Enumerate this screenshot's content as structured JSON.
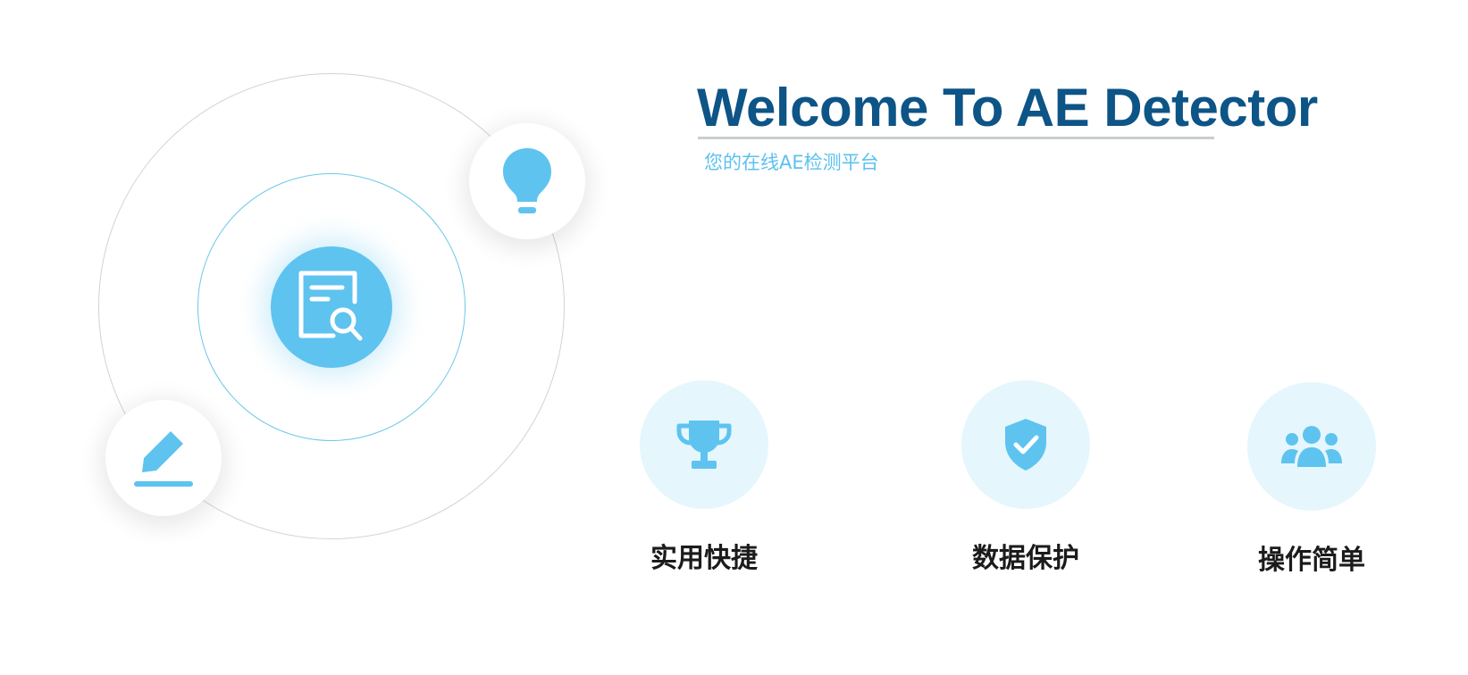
{
  "header": {
    "title": "Welcome To AE Detector",
    "subtitle": "您的在线AE检测平台"
  },
  "illustration": {
    "center_icon": "document-search-icon",
    "satellite_icons": [
      "lightbulb-icon",
      "pencil-icon"
    ]
  },
  "features": [
    {
      "label": "实用快捷",
      "icon": "trophy-icon"
    },
    {
      "label": "数据保护",
      "icon": "shield-check-icon"
    },
    {
      "label": "操作简单",
      "icon": "users-icon"
    }
  ],
  "colors": {
    "brand_dark": "#0d5487",
    "accent": "#5ec3ef",
    "feature_bg": "#e5f6fd",
    "text": "#1b1b1b"
  }
}
